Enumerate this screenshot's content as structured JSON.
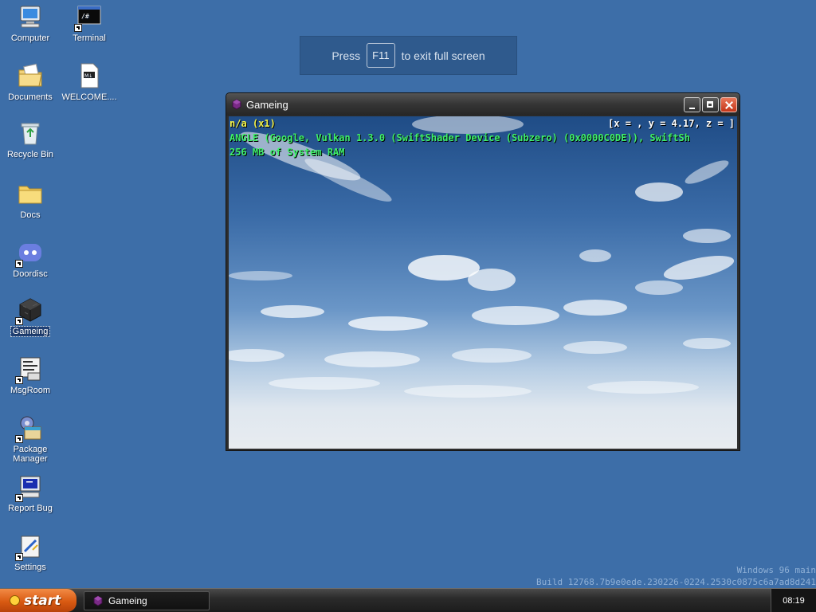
{
  "desktop": {
    "icons": [
      {
        "label": "Computer",
        "icon": "computer-icon",
        "shortcut": false
      },
      {
        "label": "Terminal",
        "icon": "terminal-icon",
        "shortcut": true
      },
      {
        "label": "Documents",
        "icon": "documents-icon",
        "shortcut": false
      },
      {
        "label": "WELCOME....",
        "icon": "markdown-file-icon",
        "shortcut": false
      },
      {
        "label": "Recycle Bin",
        "icon": "recycle-bin-icon",
        "shortcut": false
      },
      {
        "label": "Docs",
        "icon": "folder-icon",
        "shortcut": false
      },
      {
        "label": "Doordisc",
        "icon": "doordisc-icon",
        "shortcut": true
      },
      {
        "label": "Gameing",
        "icon": "gameing-cube-icon",
        "shortcut": true,
        "selected": true
      },
      {
        "label": "MsgRoom",
        "icon": "msgroom-icon",
        "shortcut": true
      },
      {
        "label": "Package Manager",
        "icon": "package-manager-icon",
        "shortcut": true
      },
      {
        "label": "Report Bug",
        "icon": "report-bug-icon",
        "shortcut": true
      },
      {
        "label": "Settings",
        "icon": "settings-icon",
        "shortcut": true
      }
    ]
  },
  "fullscreen_hint": {
    "prefix": "Press",
    "key": "F11",
    "suffix": "to exit full screen"
  },
  "window": {
    "title": "Gameing",
    "icon": "gameing-cube-icon",
    "hud": {
      "line1": "n/a (x1)",
      "line2": "ANGLE (Google, Vulkan 1.3.0 (SwiftShader Device (Subzero) (0x0000C0DE)), SwiftSh",
      "line3": "256 MB of System RAM",
      "coords": "[x = , y = 4.17, z = ]"
    },
    "colors": {
      "hud_yellow": "#f2f24a",
      "hud_green": "#3ff06a"
    }
  },
  "version": {
    "line1": "Windows 96 main",
    "line2": "Build 12768.7b9e0ede.230226-0224.2530c0875c6a7ad8d241"
  },
  "taskbar": {
    "start_label": "start",
    "task_label": "Gameing",
    "clock": "08:19",
    "start_color": "#d95a12"
  }
}
